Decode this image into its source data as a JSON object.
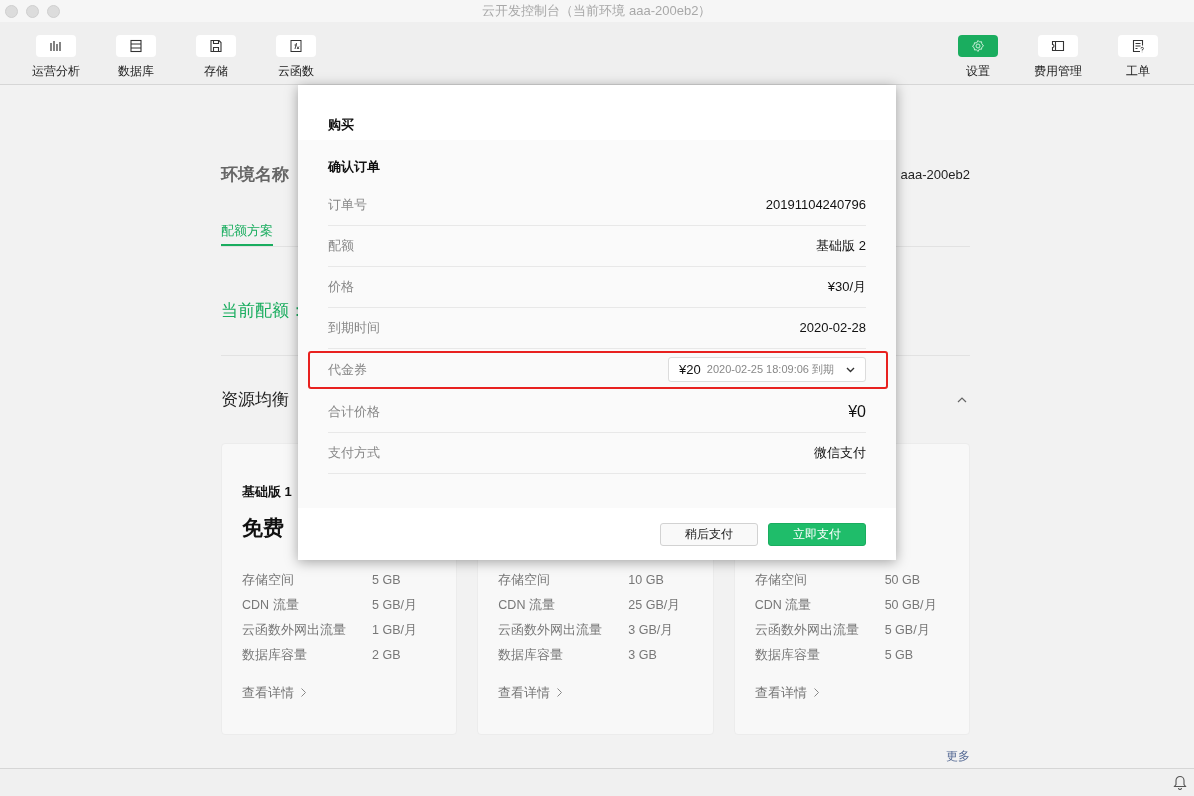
{
  "window": {
    "title": "云开发控制台（当前环境 aaa-200eb2）"
  },
  "toolbar": {
    "left": [
      {
        "label": "运营分析",
        "kind": "chart",
        "selected": false
      },
      {
        "label": "数据库",
        "kind": "database",
        "selected": false
      },
      {
        "label": "存储",
        "kind": "disk",
        "selected": false
      },
      {
        "label": "云函数",
        "kind": "function",
        "selected": false
      }
    ],
    "right": [
      {
        "label": "设置",
        "kind": "gear",
        "selected": true
      },
      {
        "label": "费用管理",
        "kind": "ticket",
        "selected": false
      },
      {
        "label": "工单",
        "kind": "form",
        "selected": false
      }
    ]
  },
  "environment": {
    "label": "环境名称",
    "value": "aaa-200eb2"
  },
  "tabs": [
    {
      "label": "配额方案",
      "selected": true
    }
  ],
  "current_quota": {
    "label": "当前配额："
  },
  "section": {
    "title": "资源均衡",
    "expanded": true
  },
  "plans": [
    {
      "name": "基础版 1",
      "price": "免费",
      "specs": [
        {
          "label": "存储空间",
          "value": "5 GB"
        },
        {
          "label": "CDN 流量",
          "value": "5 GB/月"
        },
        {
          "label": "云函数外网出流量",
          "value": "1 GB/月"
        },
        {
          "label": "数据库容量",
          "value": "2 GB"
        }
      ],
      "details_link": "查看详情"
    },
    {
      "specs": [
        {
          "label": "存储空间",
          "value": "10 GB"
        },
        {
          "label": "CDN 流量",
          "value": "25 GB/月"
        },
        {
          "label": "云函数外网出流量",
          "value": "3 GB/月"
        },
        {
          "label": "数据库容量",
          "value": "3 GB"
        }
      ],
      "details_link": "查看详情"
    },
    {
      "specs": [
        {
          "label": "存储空间",
          "value": "50 GB"
        },
        {
          "label": "CDN 流量",
          "value": "50 GB/月"
        },
        {
          "label": "云函数外网出流量",
          "value": "5 GB/月"
        },
        {
          "label": "数据库容量",
          "value": "5 GB"
        }
      ],
      "details_link": "查看详情"
    }
  ],
  "more_link": "更多",
  "dialog": {
    "title": "购买",
    "heading": "确认订单",
    "rows": [
      {
        "label": "订单号",
        "kind": "text",
        "value": "20191104240796",
        "highlighted": false
      },
      {
        "label": "配额",
        "kind": "text",
        "value": "基础版 2",
        "highlighted": false
      },
      {
        "label": "价格",
        "kind": "text",
        "value": "¥30/月",
        "highlighted": false
      },
      {
        "label": "到期时间",
        "kind": "text",
        "value": "2020-02-28",
        "highlighted": false
      },
      {
        "label": "代金券",
        "kind": "select",
        "value": "¥20",
        "note": "2020-02-25 18:09:06 到期",
        "highlighted": true
      },
      {
        "label": "合计价格",
        "kind": "total",
        "value": "¥0",
        "highlighted": false
      },
      {
        "label": "支付方式",
        "kind": "text",
        "value": "微信支付",
        "highlighted": false
      }
    ],
    "buttons": [
      {
        "label": "稍后支付",
        "primary": false
      },
      {
        "label": "立即支付",
        "primary": true
      }
    ]
  }
}
